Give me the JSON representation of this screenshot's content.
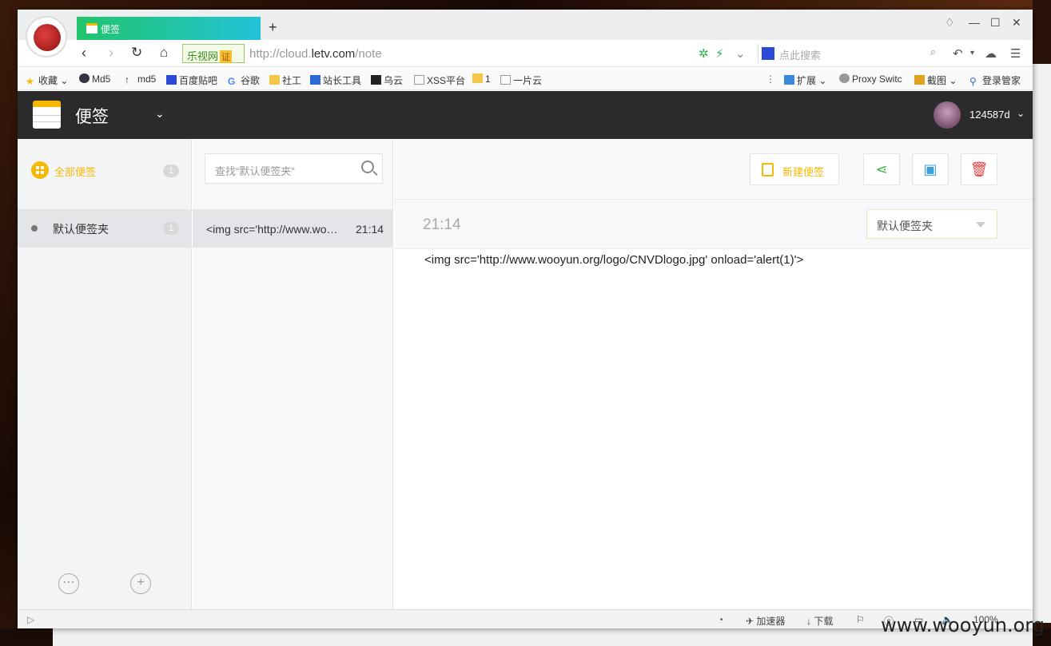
{
  "browser": {
    "tab_title": "便签",
    "new_tab_symbol": "+",
    "site_badge": "乐视网",
    "site_cert": "证",
    "url_prefix": "http://cloud.",
    "url_domain": "letv.com",
    "url_path": "/note",
    "search_placeholder": "点此搜索"
  },
  "bookmarks": [
    {
      "label": "收藏",
      "icon": "star-icon"
    },
    {
      "label": "Md5",
      "icon": "globe-icon"
    },
    {
      "label": "md5",
      "icon": "arrow-icon"
    },
    {
      "label": "百度贴吧",
      "icon": "baidu-icon"
    },
    {
      "label": "谷歌",
      "icon": "google-icon"
    },
    {
      "label": "社工",
      "icon": "folder-icon"
    },
    {
      "label": "站长工具",
      "icon": "tool-icon"
    },
    {
      "label": "乌云",
      "icon": "wooyun-icon"
    },
    {
      "label": "XSS平台",
      "icon": "page-icon"
    },
    {
      "label": "1",
      "icon": "folder-icon"
    },
    {
      "label": "一片云",
      "icon": "page-icon"
    }
  ],
  "bookmarks_right": [
    {
      "label": "扩展",
      "icon": "extension-icon"
    },
    {
      "label": "Proxy Switc",
      "icon": "proxy-icon"
    },
    {
      "label": "截图",
      "icon": "screenshot-icon"
    },
    {
      "label": "登录管家",
      "icon": "login-icon"
    }
  ],
  "app": {
    "title": "便签",
    "username": "124587d"
  },
  "sidebar": {
    "all_label": "全部便签",
    "all_count": "1",
    "folder_label": "默认便签夹",
    "folder_count": "1"
  },
  "notes": {
    "search_placeholder": "查找“默认便签夹”",
    "items": [
      {
        "preview": "<img src='http://www.wooyun.org/logo/CNVDlogo.jpg' onload='alert(1)'>",
        "time": "21:14"
      }
    ]
  },
  "toolbar": {
    "new_note_label": "新建便签"
  },
  "editor": {
    "time": "21:14",
    "folder": "默认便签夹",
    "content": "<img src='http://www.wooyun.org/logo/CNVDlogo.jpg' onload='alert(1)'>"
  },
  "statusbar": {
    "accelerator": "加速器",
    "download": "下载",
    "zoom": "100%"
  },
  "watermark": "www.wooyun.org",
  "colors": {
    "accent": "#f6b800",
    "share": "#3cb84a",
    "image": "#3aa0e0",
    "delete": "#e84040",
    "header_bg": "#2b2b2e"
  }
}
